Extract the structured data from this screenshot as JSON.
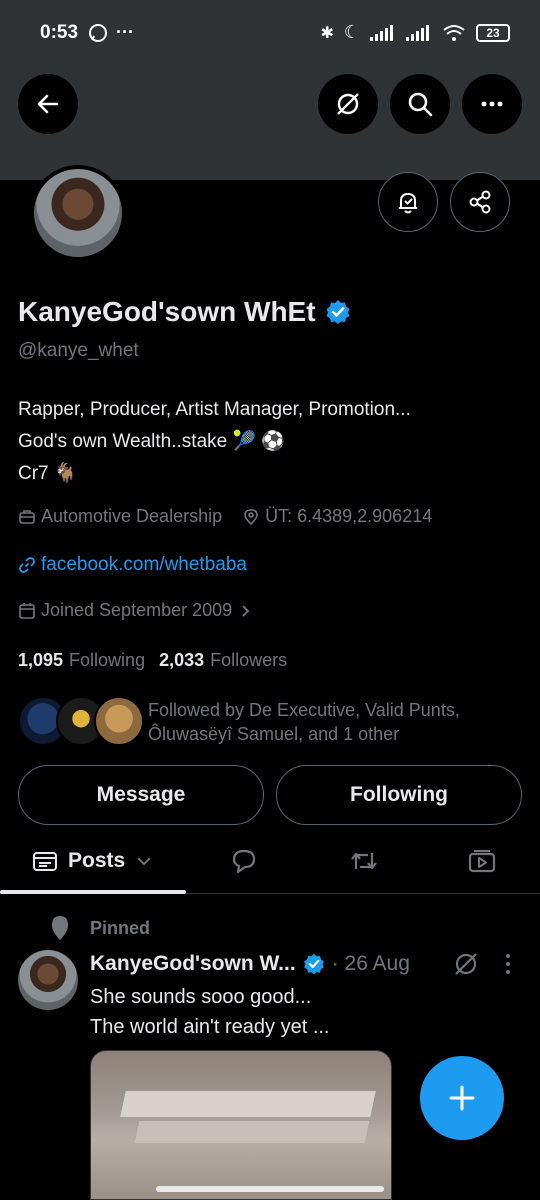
{
  "status_bar": {
    "time": "0:53",
    "battery": "23"
  },
  "profile": {
    "display_name": "KanyeGod'sown WhEt",
    "handle": "@kanye_whet",
    "bio_lines": [
      "Rapper, Producer, Artist Manager, Promotion...",
      "God's own Wealth..stake 🎾 ⚽",
      "Cr7 🐐"
    ],
    "category": "Automotive Dealership",
    "location": "ÜT: 6.4389,2.906214",
    "website": "facebook.com/whetbaba",
    "joined": "Joined September 2009",
    "following_count": "1,095",
    "following_label": "Following",
    "followers_count": "2,033",
    "followers_label": "Followers",
    "followed_by": "Followed by De Executive, Valid Punts, Ôluwasëyî Samuel, and 1 other",
    "message_label": "Message",
    "following_button_label": "Following"
  },
  "tabs": {
    "posts_label": "Posts"
  },
  "post": {
    "pinned_label": "Pinned",
    "author": "KanyeGod'sown W...",
    "date": "· 26 Aug",
    "text_line1": "She sounds sooo good...",
    "text_line2": "The world ain't ready yet ..."
  },
  "colors": {
    "accent": "#1d9bf0",
    "background": "#000000",
    "muted": "#71767b",
    "banner": "#2f3336"
  },
  "icons": [
    "back-arrow-icon",
    "grok-icon",
    "search-icon",
    "more-horizontal-icon",
    "bell-check-icon",
    "share-icon",
    "verified-badge-icon",
    "briefcase-icon",
    "location-pin-icon",
    "link-icon",
    "calendar-icon",
    "posts-tab-icon",
    "chevron-down-icon",
    "reply-icon",
    "repost-icon",
    "media-icon",
    "pin-icon",
    "plus-icon"
  ]
}
